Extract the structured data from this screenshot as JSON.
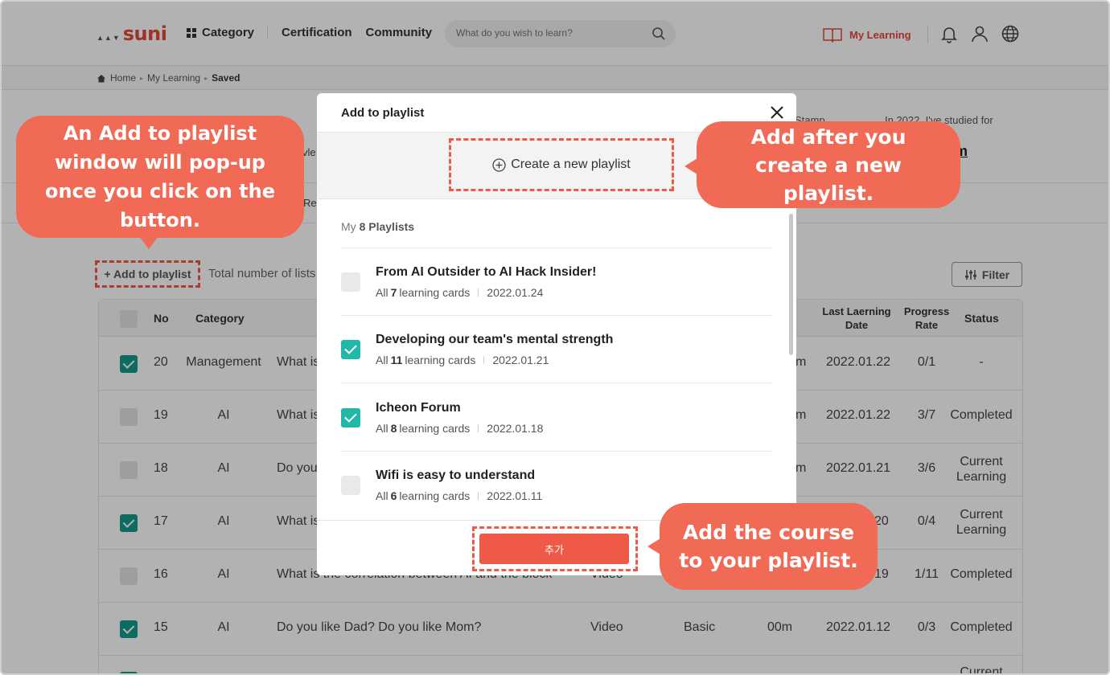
{
  "header": {
    "logo": "suni",
    "category": "Category",
    "certification": "Certification",
    "community": "Community",
    "search_placeholder": "What do you wish to learn?",
    "my_learning": "My Learning"
  },
  "breadcrumb": {
    "home": "Home",
    "my_learning": "My Learning",
    "current": "Saved"
  },
  "background": {
    "stamp": "Stamp",
    "studied": "In 2022, I've studied for",
    "big_value": "m",
    "tab_partial": "Re",
    "partial_text": "vle"
  },
  "toolbar": {
    "add_to_playlist": "+ Add to playlist",
    "total": "Total number of lists",
    "filter": "Filter"
  },
  "table": {
    "headers": {
      "no": "No",
      "category": "Category",
      "last_learning_date": "Last Laerning Date",
      "progress_rate": "Progress Rate",
      "status": "Status"
    },
    "rows": [
      {
        "checked": true,
        "no": "20",
        "category": "Management",
        "title": "What is",
        "time": "m",
        "date": "2022.01.22",
        "progress": "0/1",
        "status": "-"
      },
      {
        "checked": false,
        "no": "19",
        "category": "AI",
        "title": "What is",
        "time": "m",
        "date": "2022.01.22",
        "progress": "3/7",
        "status": "Completed"
      },
      {
        "checked": false,
        "no": "18",
        "category": "AI",
        "title": "Do you",
        "time": "m",
        "date": "2022.01.21",
        "progress": "3/6",
        "status": "Current Learning"
      },
      {
        "checked": true,
        "no": "17",
        "category": "AI",
        "title": "What is",
        "time": "",
        "date": "20",
        "progress": "0/4",
        "status": "Current Learning"
      },
      {
        "checked": false,
        "no": "16",
        "category": "AI",
        "title": "What is the correlation between AI and the block",
        "type": "Video",
        "time": "",
        "date": "19",
        "progress": "1/11",
        "status": "Completed"
      },
      {
        "checked": true,
        "no": "15",
        "category": "AI",
        "title": "Do you like Dad? Do you like Mom?",
        "type": "Video",
        "level": "Basic",
        "time": "00m",
        "date": "2022.01.12",
        "progress": "0/3",
        "status": "Completed"
      },
      {
        "checked": true,
        "no": "",
        "category": "",
        "title": "",
        "time": "",
        "date": "",
        "progress": "",
        "status": "Current"
      }
    ]
  },
  "modal": {
    "title": "Add to playlist",
    "create_label": "Create a new playlist",
    "my_prefix": "My",
    "my_count": "8",
    "my_suffix": "Playlists",
    "playlists": [
      {
        "title": "From AI Outsider to AI Hack Insider!",
        "all": "All",
        "count": "7",
        "unit": "learning cards",
        "date": "2022.01.24",
        "checked": false
      },
      {
        "title": "Developing our team's mental strength",
        "all": "All",
        "count": "11",
        "unit": "learning cards",
        "date": "2022.01.21",
        "checked": true
      },
      {
        "title": "Icheon Forum",
        "all": "All",
        "count": "8",
        "unit": "learning cards",
        "date": "2022.01.18",
        "checked": true
      },
      {
        "title": "Wifi is easy to understand",
        "all": "All",
        "count": "6",
        "unit": "learning cards",
        "date": "2022.01.11",
        "checked": false
      }
    ],
    "confirm_label": "추가"
  },
  "callouts": {
    "c1": "An Add to playlist window will pop-up once you click on the button.",
    "c2": "Add after you create a new playlist.",
    "c3": "Add the course to your playlist."
  },
  "colors": {
    "accent": "#ef5a47",
    "check_on": "#22b8a9",
    "callout": "#f06a55"
  }
}
